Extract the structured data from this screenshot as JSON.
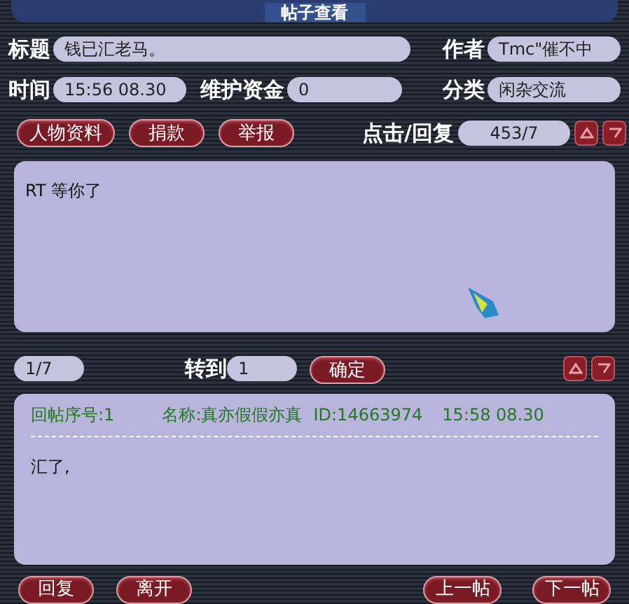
{
  "window": {
    "title": "帖子查看"
  },
  "fields": [
    {
      "label": "标题",
      "value": "钱已汇老马。"
    },
    {
      "label": "作者",
      "value": "Tmc\"催不中"
    },
    {
      "label": "时间",
      "value": "15:56 08.30"
    },
    {
      "label": "维护资金",
      "value": "0"
    },
    {
      "label": "分类",
      "value": "闲杂交流"
    }
  ],
  "actions": [
    "人物资料",
    "捐款",
    "举报"
  ],
  "stats": {
    "label": "点击/回复",
    "value": "453/7"
  },
  "post": {
    "body": "RT 等你了"
  },
  "pager": {
    "page": "1/7",
    "goto_label": "转到",
    "goto_value": "1",
    "confirm": "确定"
  },
  "reply": {
    "number": "回帖序号:1",
    "name": "名称:真亦假假亦真",
    "id": "ID:14663974",
    "time": "15:58 08.30",
    "body": "汇了,"
  },
  "footer_left": [
    "回复",
    "离开"
  ],
  "footer_right": [
    "上一帖",
    "下一帖"
  ]
}
